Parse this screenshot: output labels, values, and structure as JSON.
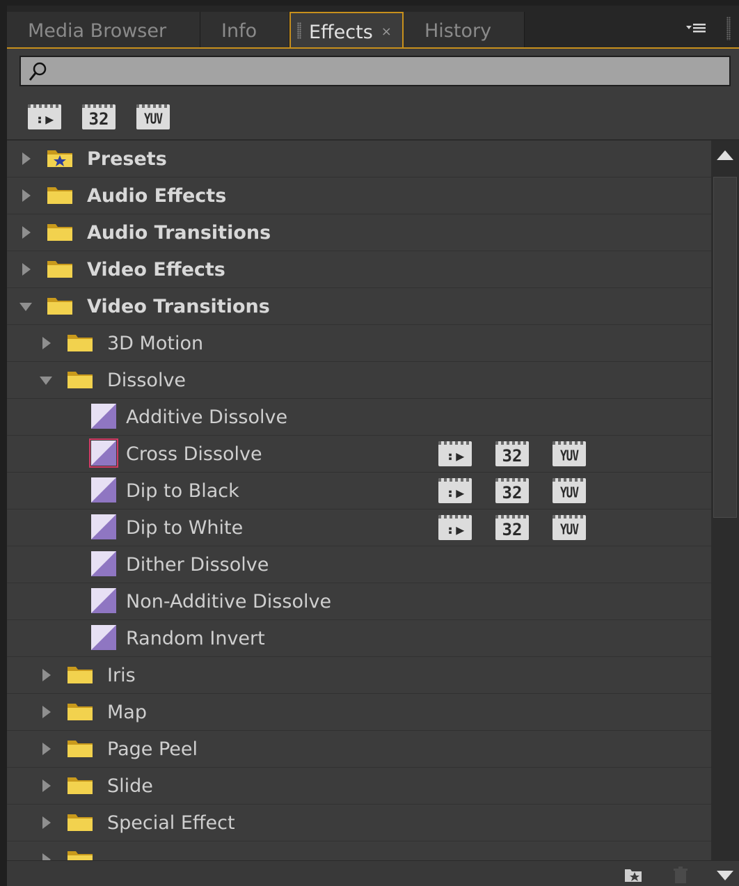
{
  "tabs": [
    {
      "label": "Media Browser",
      "active": false
    },
    {
      "label": "Info",
      "active": false
    },
    {
      "label": "Effects",
      "active": true,
      "close_glyph": "×"
    },
    {
      "label": "History",
      "active": false
    }
  ],
  "panel_menu_icon": "panel-menu-icon",
  "search": {
    "value": "",
    "placeholder": "",
    "icon": "search-icon"
  },
  "filters": {
    "accelerated": "⠆▶",
    "bit32": "32",
    "yuv": "YUV"
  },
  "tree": {
    "presets": "Presets",
    "audio_effects": "Audio Effects",
    "audio_transitions": "Audio Transitions",
    "video_effects": "Video Effects",
    "video_transitions": "Video Transitions",
    "motion_3d": "3D Motion",
    "dissolve": "Dissolve",
    "additive_dissolve": "Additive Dissolve",
    "cross_dissolve": "Cross Dissolve",
    "dip_to_black": "Dip to Black",
    "dip_to_white": "Dip to White",
    "dither_dissolve": "Dither Dissolve",
    "non_additive_dissolve": "Non-Additive Dissolve",
    "random_invert": "Random Invert",
    "iris": "Iris",
    "map": "Map",
    "page_peel": "Page Peel",
    "slide": "Slide",
    "special_effect": "Special Effect"
  },
  "badges": {
    "accel": "⠆▶",
    "b32": "32",
    "yuv": "YUV"
  },
  "colors": {
    "accent": "#c8901c",
    "panel_bg": "#3c3c3c",
    "folder": "#f2d24e",
    "transition_icon": "#a48bd0",
    "selection_outline": "#d23a64"
  }
}
